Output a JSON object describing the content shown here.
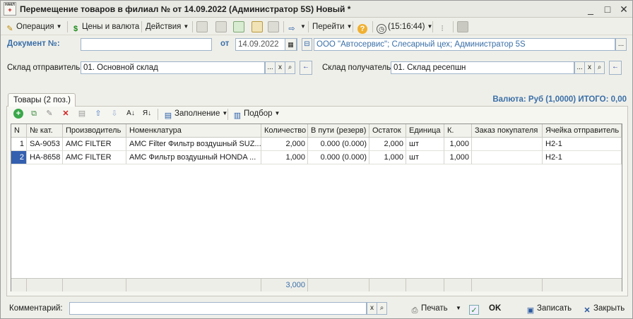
{
  "window": {
    "title": "Перемещение товаров в филиал №  от 14.09.2022 (Администратор 5S) Новый *",
    "app_icon_text": "НАКЛ",
    "minimize": "_",
    "maximize": "□",
    "close": "✕"
  },
  "toolbar": {
    "operation": "Операция",
    "prices": "Цены и валюта",
    "actions": "Действия",
    "goto": "Перейти",
    "help": "?",
    "time": "(15:16:44)"
  },
  "header": {
    "doc_label": "Документ №:",
    "doc_value": "",
    "date_label": "от",
    "date_value": "14.09.2022",
    "org_value": "ООО \"Автосервис\"; Слесарный цех; Администратор 5S",
    "org_button": "..."
  },
  "warehouses": {
    "sender_label": "Склад отправитель:",
    "sender_value": "01. Основной склад",
    "receiver_label": "Склад получатель:",
    "receiver_value": "01. Склад ресепшн",
    "select_btn": "...",
    "clear_btn": "x",
    "search_btn": "🔍",
    "goto_btn": "←"
  },
  "tab": {
    "label": "Товары (2 поз.)"
  },
  "totals": {
    "text": "Валюта: Руб (1,0000) ИТОГО: 0,00"
  },
  "grid_toolbar": {
    "fill": "Заполнение",
    "selection": "Подбор"
  },
  "table": {
    "columns": [
      "N",
      "№ кат.",
      "Производитель",
      "Номенклатура",
      "Количество",
      "В пути (резерв)",
      "Остаток",
      "Единица",
      "К.",
      "Заказ покупателя",
      "Ячейка отправитель"
    ],
    "rows": [
      [
        "1",
        "SA-9053",
        "AMC FILTER",
        "AMC Filter Фильтр воздушный SUZ...",
        "2,000",
        "0.000 (0.000)",
        "2,000",
        "шт",
        "1,000",
        "",
        "H2-1"
      ],
      [
        "2",
        "HA-8658",
        "AMC FILTER",
        "AMC Фильтр воздушный HONDA ...",
        "1,000",
        "0.000 (0.000)",
        "1,000",
        "шт",
        "1,000",
        "",
        "H2-1"
      ]
    ],
    "footer_quantity": "3,000"
  },
  "bottom": {
    "comment_label": "Комментарий:",
    "comment_value": "",
    "print": "Печать",
    "ok": "OK",
    "save": "Записать",
    "close": "Закрыть"
  }
}
